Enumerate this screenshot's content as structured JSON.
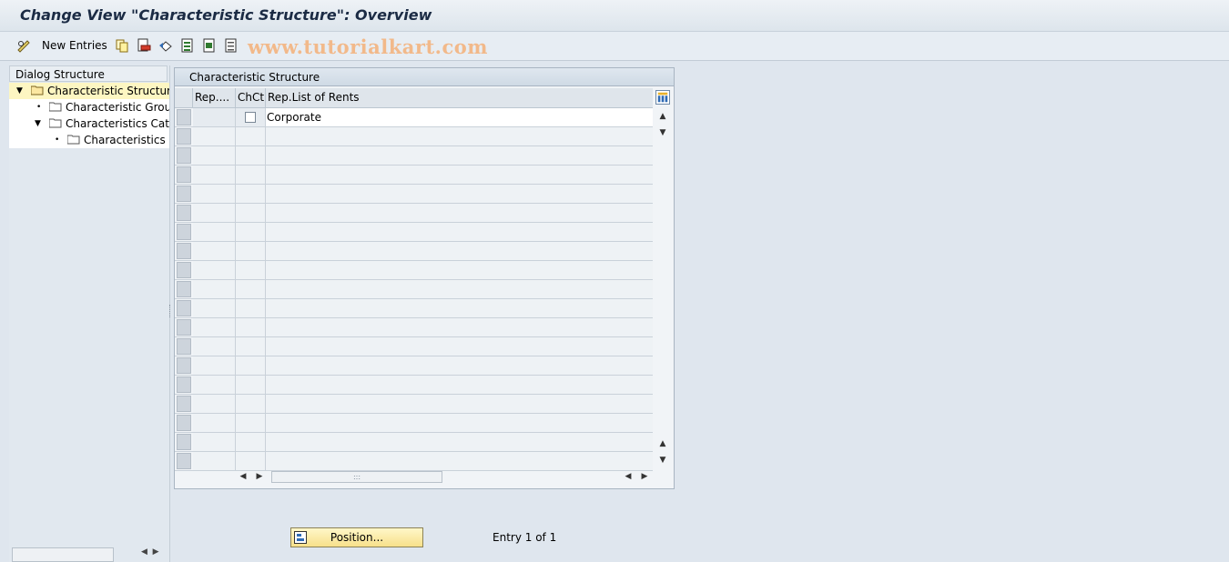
{
  "window": {
    "title": "Change View \"Characteristic Structure\": Overview"
  },
  "toolbar": {
    "new_entries_label": "New Entries",
    "watermark": "www.tutorialkart.com",
    "icons": [
      "glasses-edit-icon",
      "copy-icon",
      "delete-icon",
      "undo-icon",
      "select-all-icon",
      "select-block-icon",
      "deselect-all-icon"
    ]
  },
  "dialog_structure": {
    "header": "Dialog Structure",
    "nodes": [
      {
        "label": "Characteristic Structure",
        "level": 0,
        "expanded": true,
        "selected": true
      },
      {
        "label": "Characteristic Groups",
        "level": 1,
        "expanded": false,
        "selected": false
      },
      {
        "label": "Characteristics Categ",
        "level": 1,
        "expanded": true,
        "selected": false
      },
      {
        "label": "Characteristics pe",
        "level": 2,
        "expanded": false,
        "selected": false
      }
    ]
  },
  "table": {
    "title": "Characteristic Structure",
    "columns": [
      "Rep....",
      "ChCt",
      "Rep.List of Rents"
    ],
    "rows": [
      {
        "rep": "",
        "chct": false,
        "rep_list": "Corporate"
      }
    ],
    "empty_rows": 18
  },
  "footer": {
    "position_button_label": "Position...",
    "entry_text": "Entry 1 of 1"
  },
  "colors": {
    "background": "#dfe6ee",
    "selected_node": "#fdf6c2",
    "position_button": "#f7e08a",
    "watermark": "#f2b98a"
  }
}
